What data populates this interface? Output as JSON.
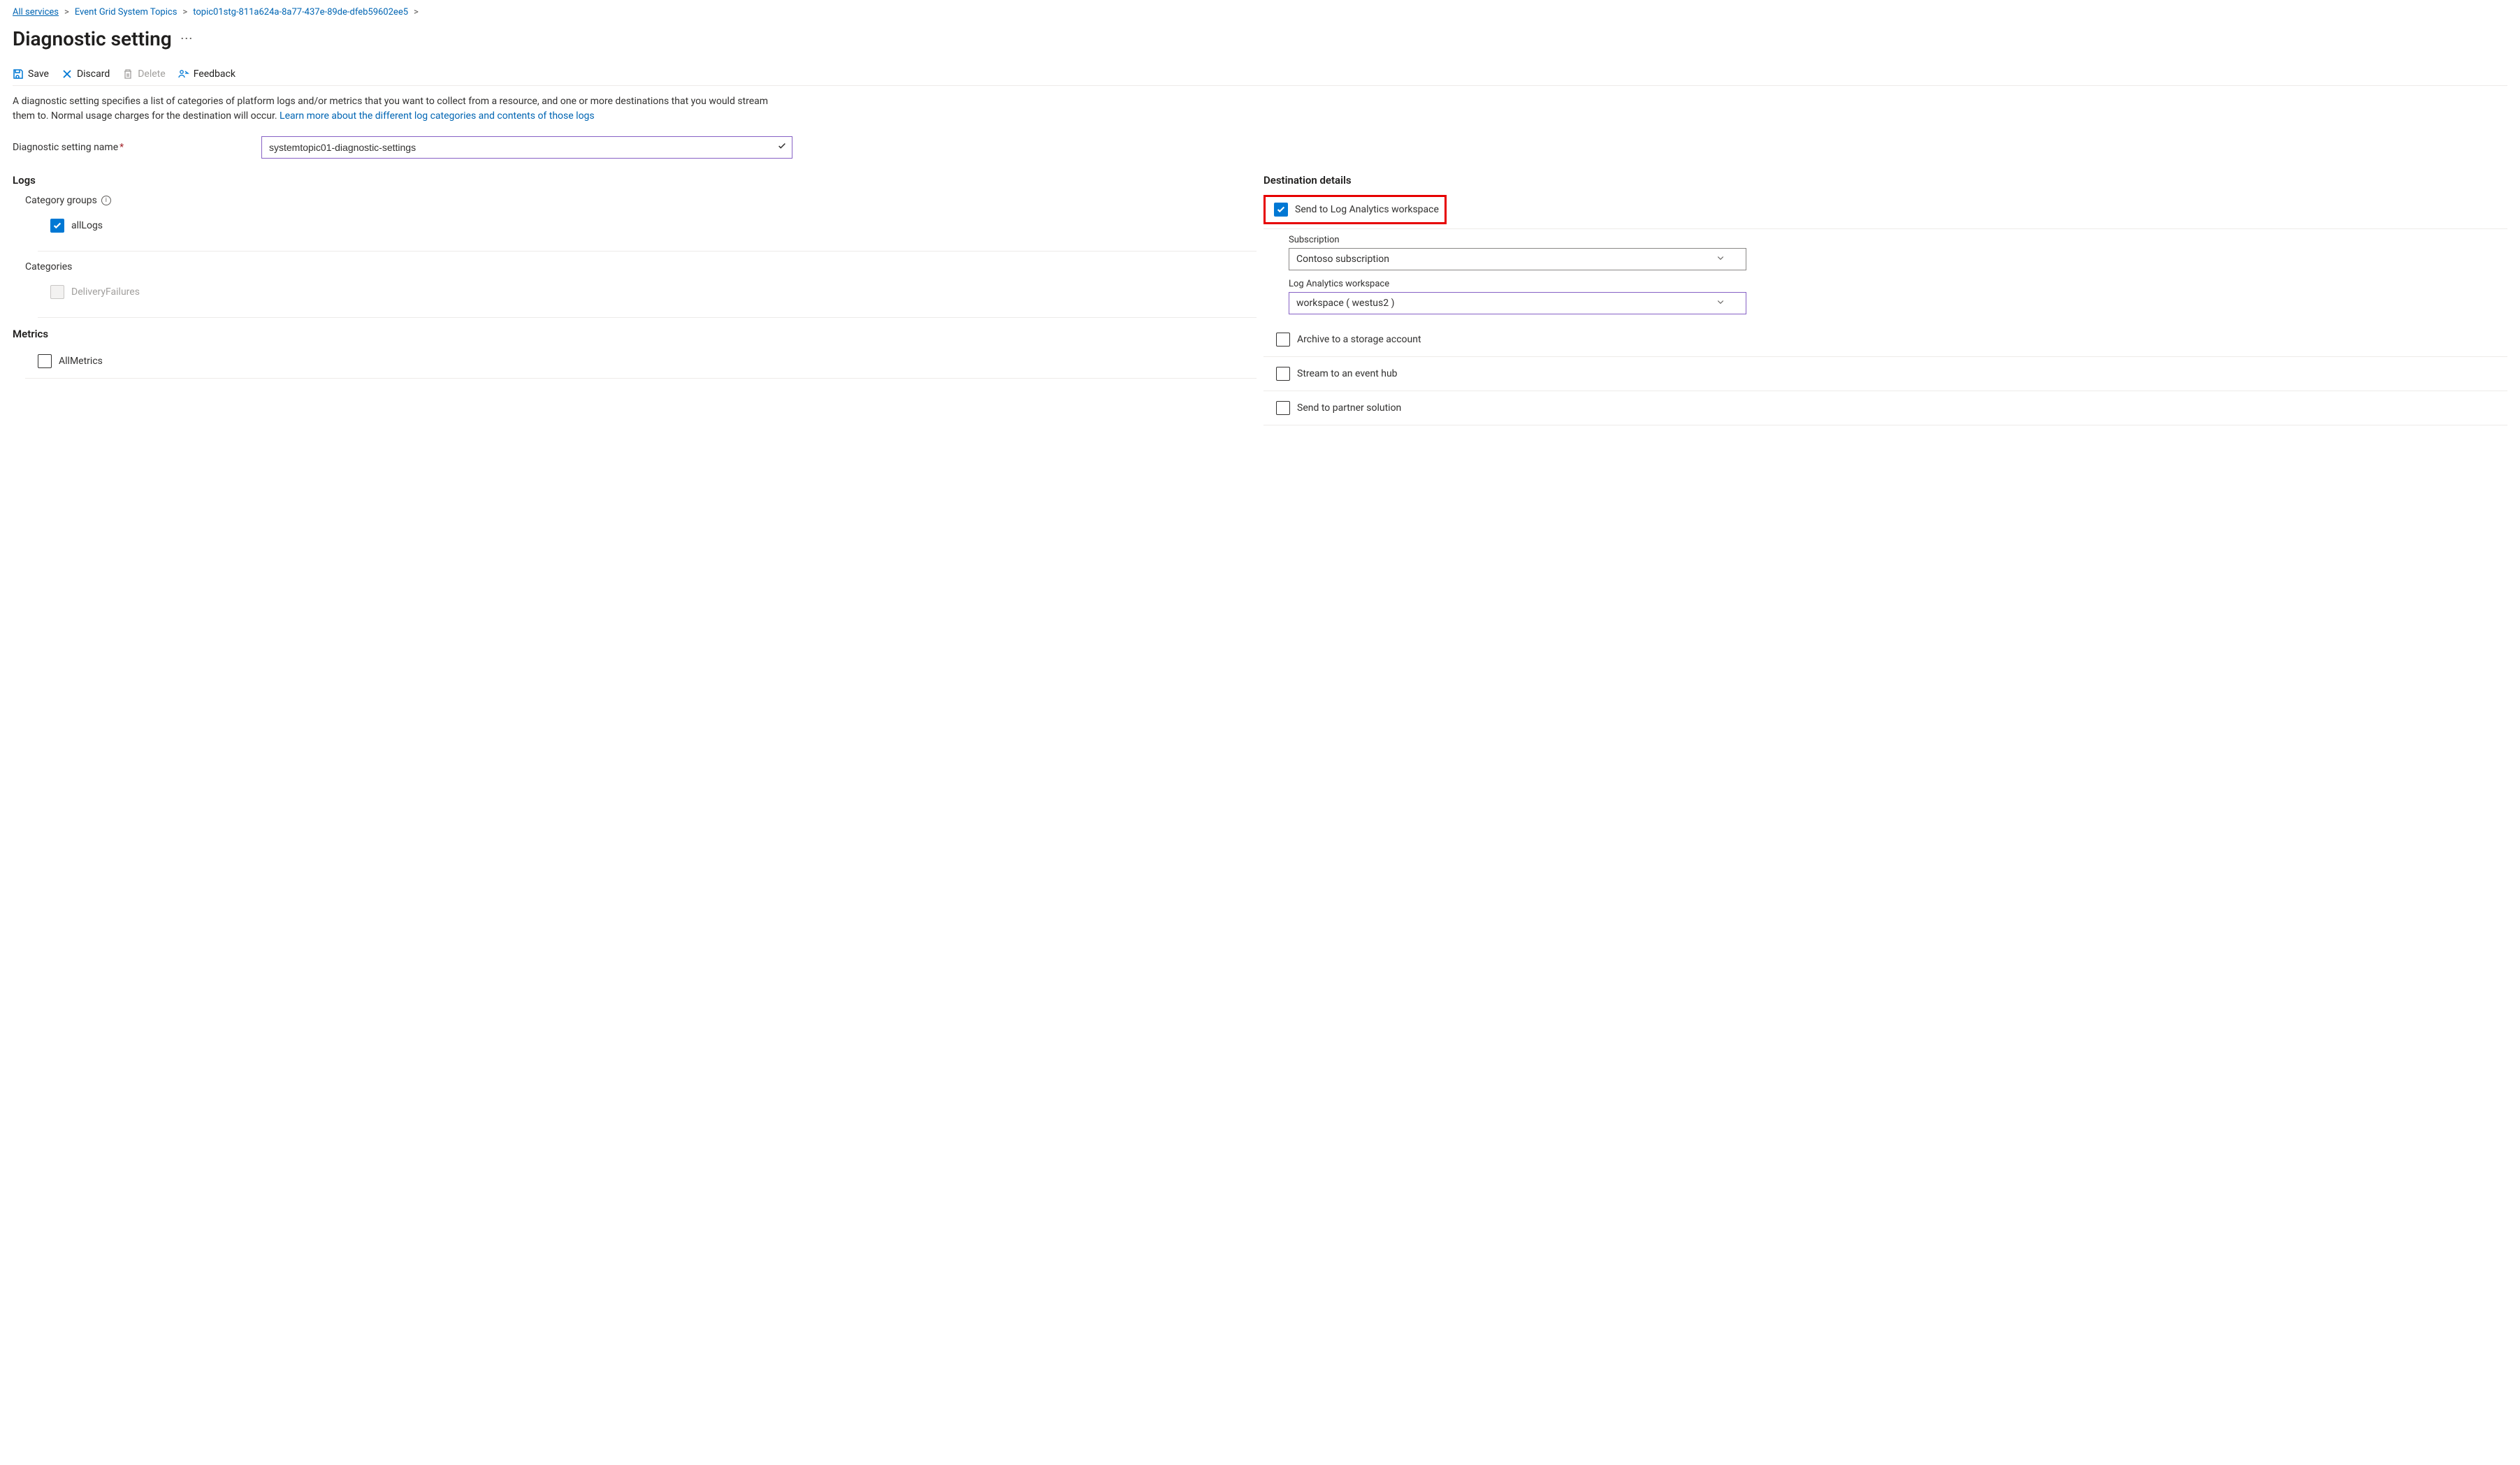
{
  "breadcrumb": {
    "items": [
      {
        "label": "All services"
      },
      {
        "label": "Event Grid System Topics"
      },
      {
        "label": "topic01stg-811a624a-8a77-437e-89de-dfeb59602ee5"
      }
    ]
  },
  "page": {
    "title": "Diagnostic setting"
  },
  "toolbar": {
    "save": "Save",
    "discard": "Discard",
    "delete": "Delete",
    "feedback": "Feedback"
  },
  "description": {
    "text": "A diagnostic setting specifies a list of categories of platform logs and/or metrics that you want to collect from a resource, and one or more destinations that you would stream them to. Normal usage charges for the destination will occur. ",
    "link": "Learn more about the different log categories and contents of those logs"
  },
  "form": {
    "name_label": "Diagnostic setting name",
    "name_value": "systemtopic01-diagnostic-settings"
  },
  "logs": {
    "heading": "Logs",
    "category_groups_label": "Category groups",
    "all_logs_label": "allLogs",
    "categories_label": "Categories",
    "delivery_failures_label": "DeliveryFailures"
  },
  "metrics": {
    "heading": "Metrics",
    "all_metrics_label": "AllMetrics"
  },
  "destinations": {
    "heading": "Destination details",
    "send_la": "Send to Log Analytics workspace",
    "subscription_label": "Subscription",
    "subscription_value": "Contoso subscription",
    "workspace_label": "Log Analytics workspace",
    "workspace_value": "workspace ( westus2 )",
    "archive_storage": "Archive to a storage account",
    "stream_eventhub": "Stream to an event hub",
    "send_partner": "Send to partner solution"
  }
}
